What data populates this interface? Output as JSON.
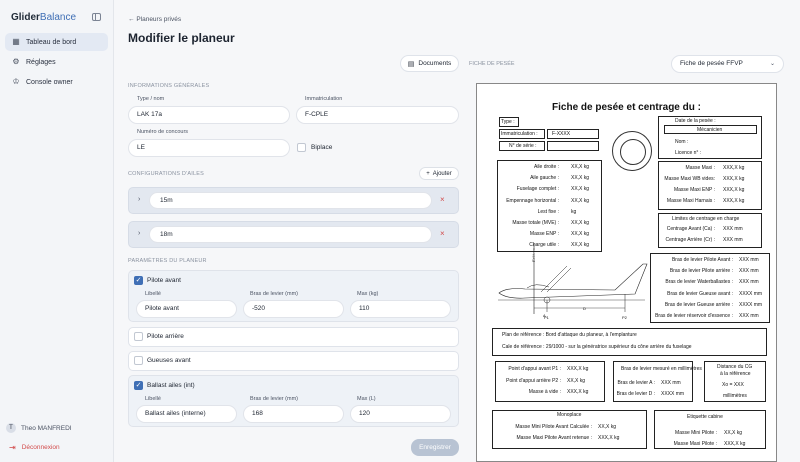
{
  "sidebar": {
    "logo_a": "Glider",
    "logo_b": "Balance",
    "items": [
      {
        "label": "Tableau de bord",
        "icon": "dashboard-icon"
      },
      {
        "label": "Réglages",
        "icon": "gear-icon"
      },
      {
        "label": "Console owner",
        "icon": "crown-icon"
      }
    ],
    "user_initial": "T",
    "user_name": "Theo MANFREDI",
    "logout": "Déconnexion"
  },
  "header": {
    "back": "Planeurs privés",
    "title": "Modifier le planeur"
  },
  "general": {
    "section": "INFORMATIONS GÉNÉRALES",
    "type_label": "Type / nom",
    "type_value": "LAK 17a",
    "immat_label": "Immatriculation",
    "immat_value": "F-CPLE",
    "concours_label": "Numéro de concours",
    "concours_value": "LE",
    "biplace_label": "Biplace"
  },
  "wings": {
    "section": "CONFIGURATIONS D'AILES",
    "add_label": "Ajouter",
    "items": [
      "15m",
      "18m"
    ]
  },
  "params": {
    "section": "PARAMÈTRES DU PLANEUR",
    "col_libelle": "Libellé",
    "col_bras": "Bras de levier (mm)",
    "col_max_kg": "Max (kg)",
    "col_max_l": "Max (L)",
    "pilote_avant": {
      "label": "Pilote avant",
      "libelle": "Pilote avant",
      "bras": "-520",
      "max": "110"
    },
    "pilote_arriere": "Pilote arrière",
    "gueuses_avant": "Gueuses avant",
    "ballast": {
      "label": "Ballast ailes (int)",
      "libelle": "Ballast ailes (interne)",
      "bras": "168",
      "max": "120"
    }
  },
  "save_label": "Enregistrer",
  "right": {
    "documents": "Documents",
    "fiche_label": "FICHE DE PESÉE",
    "select_value": "Fiche de pesée FFVP"
  },
  "sheet": {
    "title": "Fiche de pesée et centrage du :",
    "type": "Type :",
    "immat": "Immatriculation :",
    "immat_val": "F-XXXX",
    "serie": "N° de série :",
    "date_pesee": "Date de la pesée :",
    "mecanicien": "Mécanicien",
    "nom": "Nom :",
    "licence": "Licence n° :",
    "weights": [
      [
        "Aile droite :",
        "XX,X kg"
      ],
      [
        "Aile gauche :",
        "XX,X kg"
      ],
      [
        "Fuselage complet :",
        "XX,X kg"
      ],
      [
        "Empennage horizontal :",
        "XX,X kg"
      ],
      [
        "Lest fixe :",
        "kg"
      ],
      [
        "Masse totale (MVE) :",
        "XX,X kg"
      ],
      [
        "Masse ENP :",
        "XX,X kg"
      ],
      [
        "Charge utile :",
        "XX,X kg"
      ]
    ],
    "masses": [
      [
        "Masse Maxi :",
        "XXX,X kg"
      ],
      [
        "Masse Maxi WB vides:",
        "XXX,X kg"
      ],
      [
        "Masse Maxi ENP :",
        "XXX,X kg"
      ],
      [
        "Masse Maxi Harnais :",
        "XXX,X kg"
      ]
    ],
    "limits_title": "Limites de centrage en charge",
    "limits": [
      [
        "Centrage Avant (Ca) :",
        "XXX mm"
      ],
      [
        "Centrage Arrière (Cr) :",
        "XXX mm"
      ]
    ],
    "bras": [
      [
        "Bras de levier Pilote Avant :",
        "XXX mm"
      ],
      [
        "Bras de levier Pilote arrière :",
        "XXX mm"
      ],
      [
        "Bras de levier Waterballastes :",
        "XXX mm"
      ],
      [
        "Bras de levier Gueuse avant :",
        "XXXX mm"
      ],
      [
        "Bras de levier Gueuse arrière :",
        "XXXX mm"
      ],
      [
        "Bras de levier réservoir d'essence :",
        "XXX mm"
      ]
    ],
    "diagram_labels": {
      "ref": "Référence",
      "p1": "P1",
      "p2": "P2",
      "a": "A",
      "d": "D"
    },
    "plan_ref": "Plan de référence : Bord d'attaque du planeur, à l'emplanture",
    "cale_ref": "Cale de référence : 29/1000   - sur la génératrice supérieur du cône arrière du fuselage",
    "appui": [
      [
        "Point d'appui avant P1 :",
        "XXX,X kg"
      ],
      [
        "Point d'appui arrière P2 :",
        "XX,X kg"
      ],
      [
        "Masse à vide :",
        "XXX,X kg"
      ]
    ],
    "mesure_title": "Bras de levier mesuré en millimètres",
    "mesure": [
      [
        "Bras de levier A :",
        "XXX mm"
      ],
      [
        "Bras de levier D :",
        "XXXX mm"
      ]
    ],
    "cg_title_1": "Distance du CG",
    "cg_title_2": "à la référence",
    "cg_val": "Xo =  XXX",
    "cg_unit": "millimètres",
    "mono_title": "Monoplace",
    "mono": [
      [
        "Masse Mini Pilote Avant Calculée :",
        "XX,X kg"
      ],
      [
        "Masse Maxi Pilote Avant retenue :",
        "XXX,X kg"
      ]
    ],
    "cabine_title": "Etiquette cabine",
    "cabine": [
      [
        "Masse Mini Pilote :",
        "XX,X kg"
      ],
      [
        "Masse Maxi Pilote :",
        "XXX,X kg"
      ]
    ]
  }
}
